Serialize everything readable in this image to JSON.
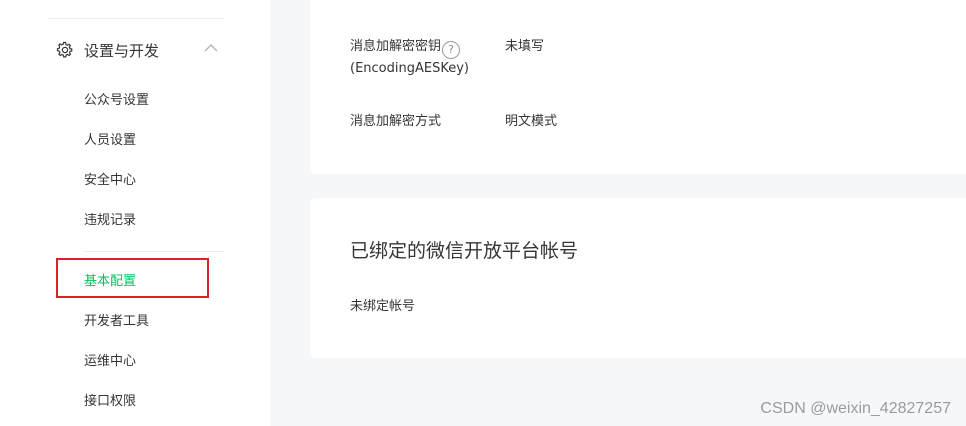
{
  "sidebar": {
    "section_title": "设置与开发",
    "items": [
      {
        "label": "公众号设置"
      },
      {
        "label": "人员设置"
      },
      {
        "label": "安全中心"
      },
      {
        "label": "违规记录"
      },
      {
        "label": "基本配置"
      },
      {
        "label": "开发者工具"
      },
      {
        "label": "运维中心"
      },
      {
        "label": "接口权限"
      }
    ]
  },
  "server_config": {
    "aes_key_label": "消息加解密密钥",
    "aes_key_sub": "(EncodingAESKey)",
    "aes_key_help": "?",
    "aes_key_value": "未填写",
    "encrypt_mode_label": "消息加解密方式",
    "encrypt_mode_value": "明文模式"
  },
  "bound_platform": {
    "title": "已绑定的微信开放平台帐号",
    "status": "未绑定帐号"
  },
  "watermark": "CSDN @weixin_42827257",
  "colors": {
    "accent": "#07c160",
    "highlight": "#d9222a"
  }
}
